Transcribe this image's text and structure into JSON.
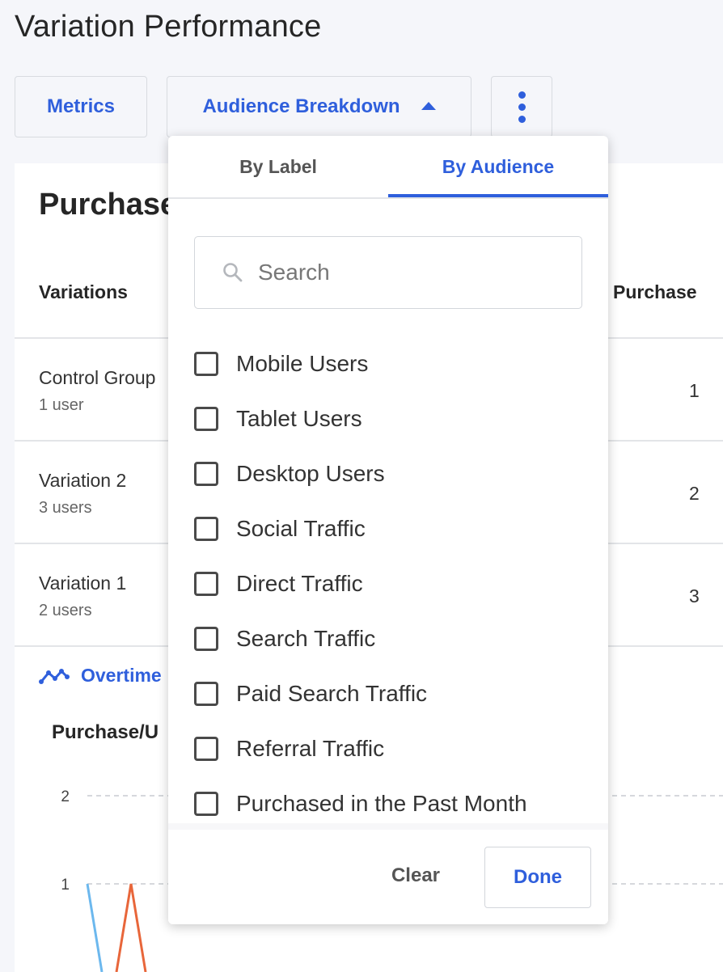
{
  "page": {
    "title": "Variation Performance"
  },
  "toolbar": {
    "metrics_label": "Metrics",
    "audience_label": "Audience Breakdown"
  },
  "card": {
    "title": "Purchase",
    "columns": {
      "variations": "Variations",
      "purchase": "Purchase"
    },
    "rows": [
      {
        "name": "Control Group",
        "users": "1 user",
        "value": "1"
      },
      {
        "name": "Variation 2",
        "users": "3 users",
        "value": "2"
      },
      {
        "name": "Variation 1",
        "users": "2 users",
        "value": "3"
      }
    ],
    "overtime_label": "Overtime",
    "chart_title": "Purchase/U"
  },
  "chart_data": {
    "type": "line",
    "title": "Purchase/U",
    "y_ticks": [
      "2",
      "1"
    ],
    "ylim": [
      0,
      2
    ],
    "grid": true,
    "series": [
      {
        "color": "#6cb8ee",
        "values": [
          1,
          0
        ]
      },
      {
        "color": "#e8663a",
        "values": [
          0,
          1,
          0
        ]
      }
    ]
  },
  "dropdown": {
    "tabs": {
      "by_label": "By Label",
      "by_audience": "By Audience",
      "active": "By Audience"
    },
    "search": {
      "placeholder": "Search",
      "value": ""
    },
    "options": [
      {
        "label": "Mobile Users",
        "checked": false
      },
      {
        "label": "Tablet Users",
        "checked": false
      },
      {
        "label": "Desktop Users",
        "checked": false
      },
      {
        "label": "Social Traffic",
        "checked": false
      },
      {
        "label": "Direct Traffic",
        "checked": false
      },
      {
        "label": "Search Traffic",
        "checked": false
      },
      {
        "label": "Paid Search Traffic",
        "checked": false
      },
      {
        "label": "Referral Traffic",
        "checked": false
      },
      {
        "label": "Purchased in the Past Month",
        "checked": false
      }
    ],
    "clear_label": "Clear",
    "done_label": "Done"
  },
  "colors": {
    "accent": "#2f5fdc",
    "background": "#f5f6fa",
    "series_blue": "#6cb8ee",
    "series_orange": "#e8663a"
  },
  "icons": {
    "caret": "caret-up-icon",
    "more": "more-vertical-icon",
    "search": "search-icon",
    "overtime": "line-chart-icon"
  }
}
